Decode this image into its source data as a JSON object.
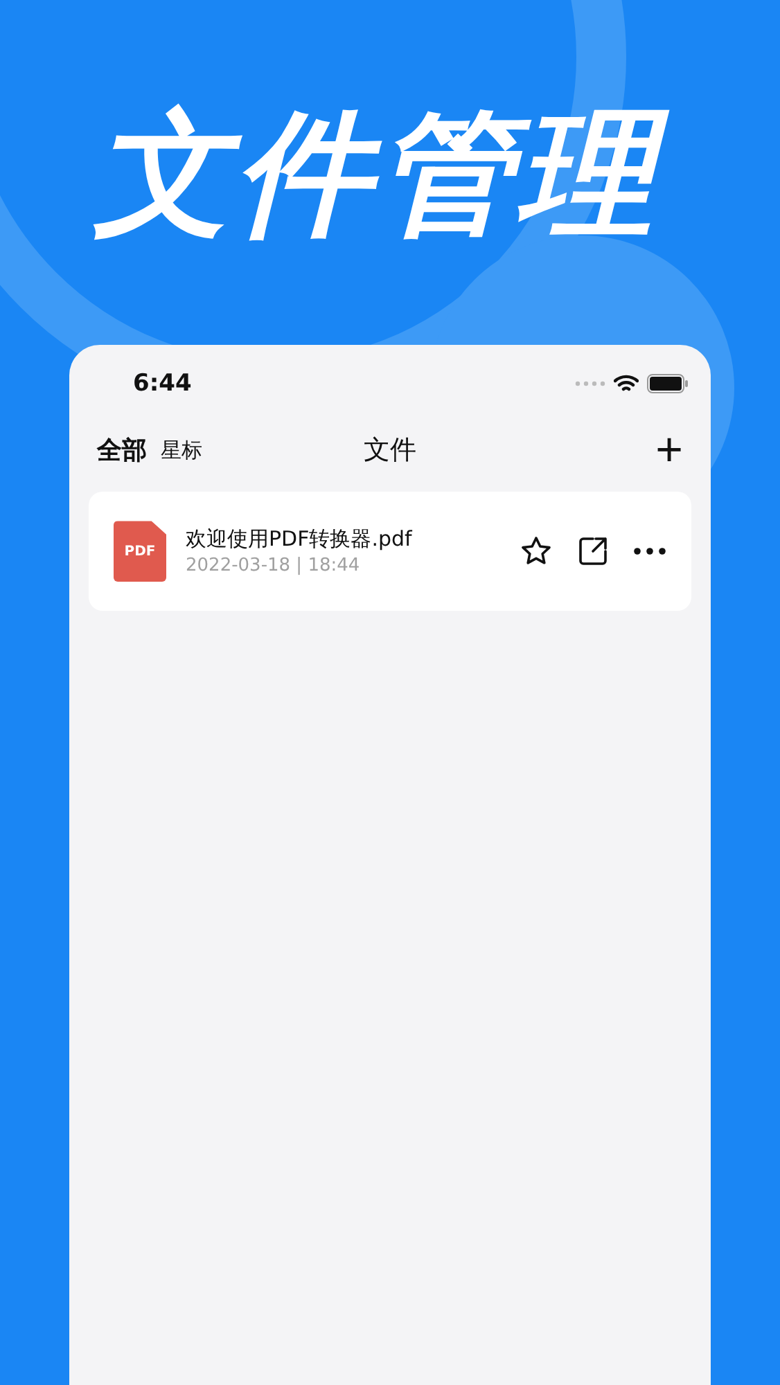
{
  "headline": "文件管理",
  "status_bar": {
    "time": "6:44"
  },
  "nav": {
    "tabs": [
      {
        "label": "全部",
        "selected": true
      },
      {
        "label": "星标",
        "selected": false
      }
    ],
    "title": "文件",
    "add_label": "+"
  },
  "files": [
    {
      "kind": "pdf",
      "badge": "PDF",
      "name": "欢迎使用PDF转换器.pdf",
      "meta": "2022-03-18 | 18:44",
      "starred": false
    }
  ]
}
